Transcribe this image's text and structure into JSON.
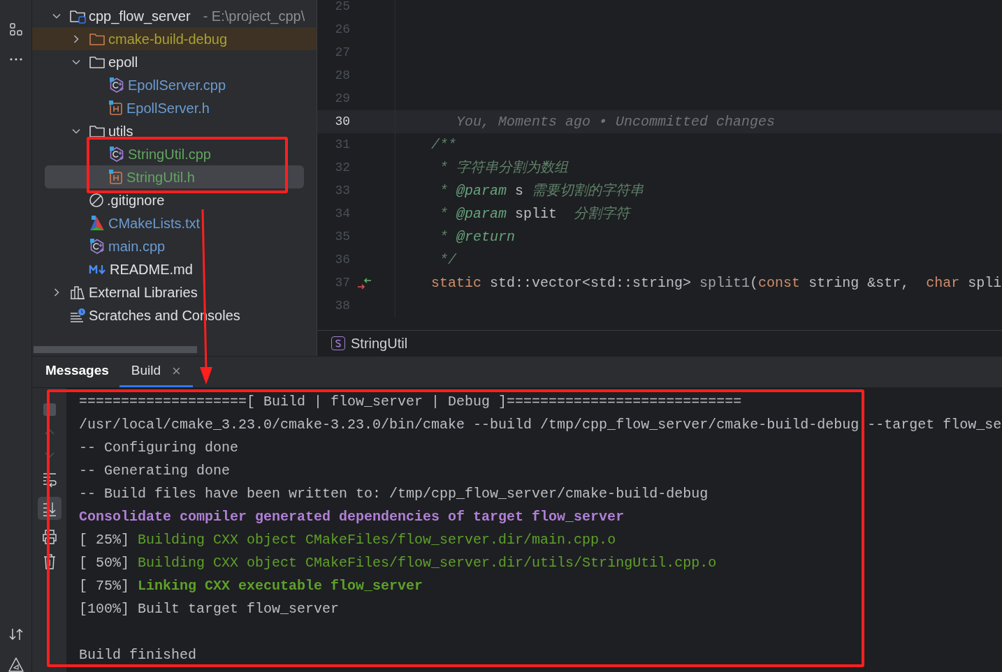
{
  "project_tree": [
    {
      "label": "cpp_flow_server",
      "path": "- E:\\project_cpp\\",
      "kind": "project",
      "color": "#dfe1e5",
      "expanded": true,
      "selected": false,
      "children": [
        {
          "label": "cmake-build-debug",
          "kind": "excluded-folder",
          "color": "#a7a136",
          "expanded": false,
          "selected": false
        },
        {
          "label": "epoll",
          "kind": "folder",
          "color": "#dfe1e5",
          "expanded": true,
          "selected": false,
          "children": [
            {
              "label": "EpollServer.cpp",
              "kind": "cpp",
              "color": "#6c9bd2",
              "selected": false
            },
            {
              "label": "EpollServer.h",
              "kind": "header",
              "color": "#6c9bd2",
              "selected": false
            }
          ]
        },
        {
          "label": "utils",
          "kind": "folder",
          "color": "#dfe1e5",
          "expanded": true,
          "selected": false,
          "children": [
            {
              "label": "StringUtil.cpp",
              "kind": "cpp",
              "color": "#62a560",
              "selected": false
            },
            {
              "label": "StringUtil.h",
              "kind": "header",
              "color": "#62a560",
              "selected": true
            }
          ]
        },
        {
          "label": ".gitignore",
          "kind": "ignore",
          "color": "#dfe1e5",
          "selected": false
        },
        {
          "label": "CMakeLists.txt",
          "kind": "cmake",
          "color": "#6c9bd2",
          "selected": false
        },
        {
          "label": "main.cpp",
          "kind": "cpp",
          "color": "#6c9bd2",
          "selected": false
        },
        {
          "label": "README.md",
          "kind": "markdown",
          "color": "#dfe1e5",
          "selected": false
        }
      ]
    },
    {
      "label": "External Libraries",
      "kind": "libraries",
      "color": "#dfe1e5",
      "expanded": false,
      "selected": false
    },
    {
      "label": "Scratches and Consoles",
      "kind": "scratches",
      "color": "#dfe1e5",
      "selected": false
    }
  ],
  "editor": {
    "lines": [
      {
        "number": "25",
        "selected": false,
        "gutter_mark": false
      },
      {
        "number": "26",
        "selected": false,
        "gutter_mark": false
      },
      {
        "number": "27",
        "selected": false,
        "gutter_mark": false
      },
      {
        "number": "28",
        "selected": false,
        "gutter_mark": false
      },
      {
        "number": "29",
        "selected": false,
        "gutter_mark": false
      },
      {
        "number": "30",
        "selected": true,
        "gutter_mark": false,
        "tokens": [
          {
            "text": "   You, Moments ago • Uncommitted changes",
            "kind": "blame"
          }
        ]
      },
      {
        "number": "31",
        "selected": false,
        "gutter_mark": false,
        "tokens": [
          {
            "text": "/**",
            "kind": "comment"
          }
        ]
      },
      {
        "number": "32",
        "selected": false,
        "gutter_mark": false,
        "tokens": [
          {
            "text": " * 字符串分割为数组",
            "kind": "comment"
          }
        ]
      },
      {
        "number": "33",
        "selected": false,
        "gutter_mark": false,
        "tokens": [
          {
            "text": " * ",
            "kind": "comment"
          },
          {
            "text": "@param",
            "kind": "doc-tag"
          },
          {
            "text": " s ",
            "kind": "plain"
          },
          {
            "text": "需要切割的字符串",
            "kind": "comment"
          }
        ]
      },
      {
        "number": "34",
        "selected": false,
        "gutter_mark": false,
        "tokens": [
          {
            "text": " * ",
            "kind": "comment"
          },
          {
            "text": "@param",
            "kind": "doc-tag"
          },
          {
            "text": " split  ",
            "kind": "plain"
          },
          {
            "text": "分割字符",
            "kind": "comment"
          }
        ]
      },
      {
        "number": "35",
        "selected": false,
        "gutter_mark": false,
        "tokens": [
          {
            "text": " * ",
            "kind": "comment"
          },
          {
            "text": "@return",
            "kind": "doc-tag"
          }
        ]
      },
      {
        "number": "36",
        "selected": false,
        "gutter_mark": false,
        "tokens": [
          {
            "text": " */",
            "kind": "comment"
          }
        ]
      },
      {
        "number": "37",
        "selected": false,
        "gutter_mark": true,
        "tokens": [
          {
            "text": "static",
            "kind": "keyword"
          },
          {
            "text": " std::vector<std::string> ",
            "kind": "plain"
          },
          {
            "text": "split1",
            "kind": "unused"
          },
          {
            "text": "(",
            "kind": "plain"
          },
          {
            "text": "const",
            "kind": "keyword"
          },
          {
            "text": " string &str,  ",
            "kind": "plain"
          },
          {
            "text": "char",
            "kind": "keyword"
          },
          {
            "text": " spli",
            "kind": "plain"
          }
        ]
      },
      {
        "number": "38",
        "selected": false,
        "gutter_mark": false
      }
    ],
    "breadcrumb": "StringUtil"
  },
  "bottom_panel": {
    "tabs": [
      {
        "label": "Messages",
        "selected": false,
        "closable": false
      },
      {
        "label": "Build",
        "selected": true,
        "closable": true
      }
    ],
    "close_glyph": "×",
    "output": [
      {
        "kind": "text",
        "tokens": [
          {
            "text": "====================[ Build | flow_server | Debug ]============================",
            "kind": "plain"
          }
        ]
      },
      {
        "kind": "text",
        "tokens": [
          {
            "text": "/usr/local/cmake_3.23.0/cmake-3.23.0/bin/cmake --build /tmp/cpp_flow_server/cmake-build-debug --target flow_se",
            "kind": "plain"
          }
        ]
      },
      {
        "kind": "text",
        "tokens": [
          {
            "text": "-- Configuring done",
            "kind": "plain"
          }
        ]
      },
      {
        "kind": "text",
        "tokens": [
          {
            "text": "-- Generating done",
            "kind": "plain"
          }
        ]
      },
      {
        "kind": "text",
        "tokens": [
          {
            "text": "-- Build files have been written to: /tmp/cpp_flow_server/cmake-build-debug",
            "kind": "plain"
          }
        ]
      },
      {
        "kind": "text",
        "tokens": [
          {
            "text": "Consolidate compiler generated dependencies of target flow_server",
            "kind": "scan"
          }
        ]
      },
      {
        "kind": "text",
        "tokens": [
          {
            "text": "[ 25%] ",
            "kind": "plain"
          },
          {
            "text": "Building CXX object CMakeFiles/flow_server.dir/main.cpp.o",
            "kind": "build"
          }
        ]
      },
      {
        "kind": "text",
        "tokens": [
          {
            "text": "[ 50%] ",
            "kind": "plain"
          },
          {
            "text": "Building CXX object CMakeFiles/flow_server.dir/utils/StringUtil.cpp.o",
            "kind": "build"
          }
        ]
      },
      {
        "kind": "text",
        "tokens": [
          {
            "text": "[ 75%] ",
            "kind": "plain"
          },
          {
            "text": "Linking CXX executable flow_server",
            "kind": "link"
          }
        ]
      },
      {
        "kind": "text",
        "tokens": [
          {
            "text": "[100%] Built target flow_server",
            "kind": "plain"
          }
        ]
      },
      {
        "kind": "blank"
      },
      {
        "kind": "text",
        "tokens": [
          {
            "text": "Build finished",
            "kind": "plain"
          }
        ]
      }
    ]
  }
}
